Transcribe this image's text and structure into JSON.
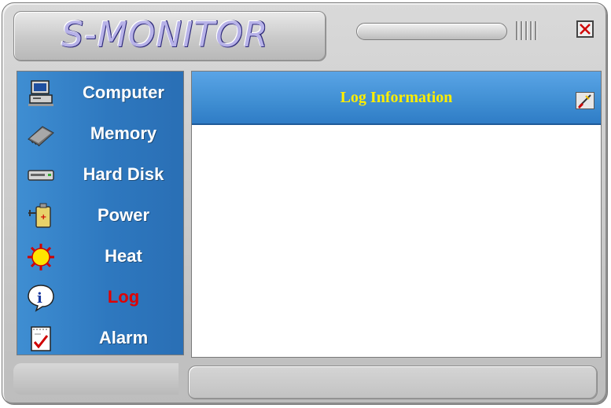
{
  "window": {
    "title": "S-MONITOR"
  },
  "sidebar": {
    "items": [
      {
        "label": "Computer",
        "icon": "computer-icon"
      },
      {
        "label": "Memory",
        "icon": "memory-icon"
      },
      {
        "label": "Hard Disk",
        "icon": "hard-disk-icon"
      },
      {
        "label": "Power",
        "icon": "power-icon"
      },
      {
        "label": "Heat",
        "icon": "heat-icon"
      },
      {
        "label": "Log",
        "icon": "info-icon",
        "active": true
      },
      {
        "label": "Alarm",
        "icon": "alarm-icon"
      }
    ]
  },
  "content": {
    "title": "Log Information",
    "clear_icon": "clear-log-icon",
    "log_text": ""
  },
  "colors": {
    "active": "#e00000",
    "header_text": "#ffee00",
    "sidebar_blue": "#2e78bf"
  }
}
